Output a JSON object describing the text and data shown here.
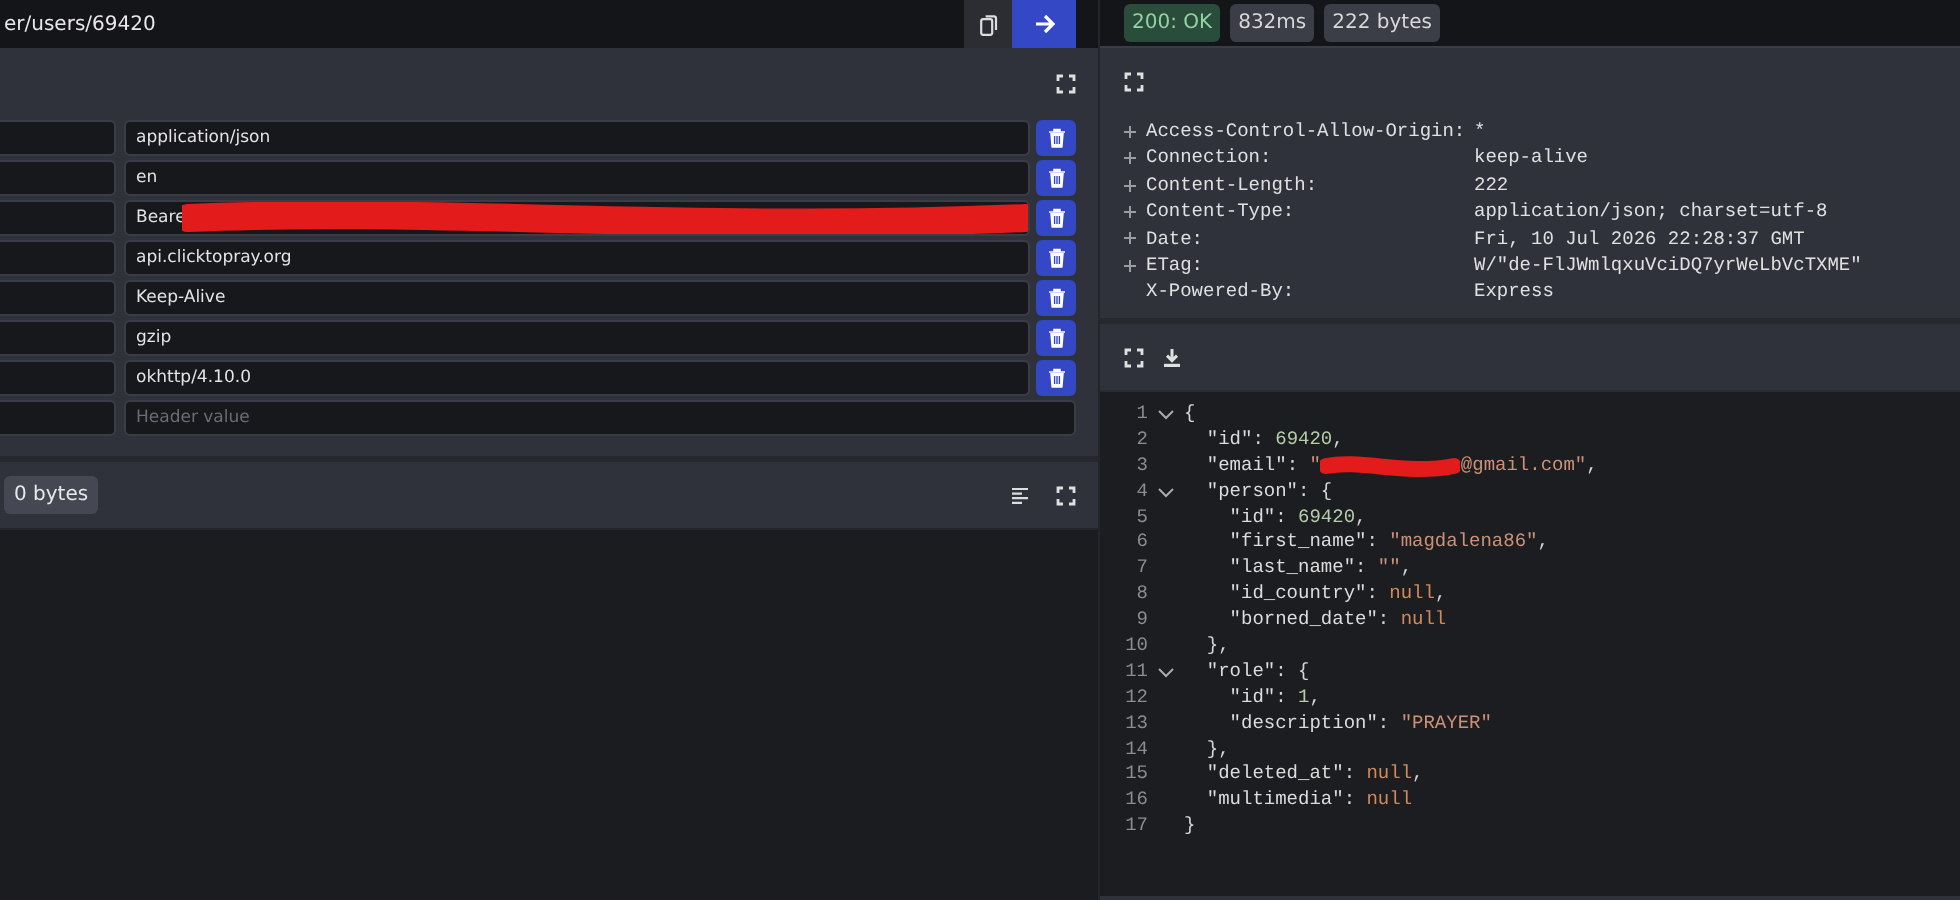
{
  "url_bar": {
    "value": "er/users/69420"
  },
  "request_headers": [
    {
      "value": "application/json",
      "redacted": false
    },
    {
      "value": "en",
      "redacted": false
    },
    {
      "value": "Beare",
      "redacted": true
    },
    {
      "value": "api.clicktopray.org",
      "redacted": false
    },
    {
      "value": "Keep-Alive",
      "redacted": false
    },
    {
      "value": "gzip",
      "redacted": false
    },
    {
      "value": "okhttp/4.10.0",
      "redacted": false
    }
  ],
  "new_header": {
    "placeholder": "Header value"
  },
  "request_body": {
    "size": "0 bytes"
  },
  "status": {
    "code": "200: OK",
    "time": "832ms",
    "size": "222 bytes"
  },
  "response_headers": [
    {
      "name": "Access-Control-Allow-Origin:",
      "value": "*",
      "expandable": true
    },
    {
      "name": "Connection:",
      "value": "keep-alive",
      "expandable": true
    },
    {
      "name": "Content-Length:",
      "value": "222",
      "expandable": true
    },
    {
      "name": "Content-Type:",
      "value": "application/json; charset=utf-8",
      "expandable": true
    },
    {
      "name": "Date:",
      "value": "Fri, 10 Jul 2026 22:28:37 GMT",
      "expandable": true
    },
    {
      "name": "ETag:",
      "value": "W/\"de-FlJWmlqxuVciDQ7yrWeLbVcTXME\"",
      "expandable": true
    },
    {
      "name": "X-Powered-By:",
      "value": "Express",
      "expandable": false
    }
  ],
  "response_body": {
    "lines": [
      {
        "number": "1",
        "foldable": true,
        "tokens": [
          {
            "kind": "punct",
            "text": "{"
          }
        ]
      },
      {
        "number": "2",
        "foldable": false,
        "tokens": [
          {
            "kind": "key",
            "text": "  \"id\""
          },
          {
            "kind": "punct",
            "text": ": "
          },
          {
            "kind": "number",
            "text": "69420"
          },
          {
            "kind": "punct",
            "text": ","
          }
        ]
      },
      {
        "number": "3",
        "foldable": false,
        "tokens": [
          {
            "kind": "key",
            "text": "  \"email\""
          },
          {
            "kind": "punct",
            "text": ": "
          },
          {
            "kind": "string",
            "text": "\""
          },
          {
            "kind": "redaction"
          },
          {
            "kind": "string",
            "text": "@gmail.com\""
          },
          {
            "kind": "punct",
            "text": ","
          }
        ]
      },
      {
        "number": "4",
        "foldable": true,
        "tokens": [
          {
            "kind": "key",
            "text": "  \"person\""
          },
          {
            "kind": "punct",
            "text": ": {"
          }
        ]
      },
      {
        "number": "5",
        "foldable": false,
        "tokens": [
          {
            "kind": "key",
            "text": "    \"id\""
          },
          {
            "kind": "punct",
            "text": ": "
          },
          {
            "kind": "number",
            "text": "69420"
          },
          {
            "kind": "punct",
            "text": ","
          }
        ]
      },
      {
        "number": "6",
        "foldable": false,
        "tokens": [
          {
            "kind": "key",
            "text": "    \"first_name\""
          },
          {
            "kind": "punct",
            "text": ": "
          },
          {
            "kind": "string",
            "text": "\"magdalena86\""
          },
          {
            "kind": "punct",
            "text": ","
          }
        ]
      },
      {
        "number": "7",
        "foldable": false,
        "tokens": [
          {
            "kind": "key",
            "text": "    \"last_name\""
          },
          {
            "kind": "punct",
            "text": ": "
          },
          {
            "kind": "string",
            "text": "\"\""
          },
          {
            "kind": "punct",
            "text": ","
          }
        ]
      },
      {
        "number": "8",
        "foldable": false,
        "tokens": [
          {
            "kind": "key",
            "text": "    \"id_country\""
          },
          {
            "kind": "punct",
            "text": ": "
          },
          {
            "kind": "null",
            "text": "null"
          },
          {
            "kind": "punct",
            "text": ","
          }
        ]
      },
      {
        "number": "9",
        "foldable": false,
        "tokens": [
          {
            "kind": "key",
            "text": "    \"borned_date\""
          },
          {
            "kind": "punct",
            "text": ": "
          },
          {
            "kind": "null",
            "text": "null"
          }
        ]
      },
      {
        "number": "10",
        "foldable": false,
        "tokens": [
          {
            "kind": "punct",
            "text": "  },"
          }
        ]
      },
      {
        "number": "11",
        "foldable": true,
        "tokens": [
          {
            "kind": "key",
            "text": "  \"role\""
          },
          {
            "kind": "punct",
            "text": ": {"
          }
        ]
      },
      {
        "number": "12",
        "foldable": false,
        "tokens": [
          {
            "kind": "key",
            "text": "    \"id\""
          },
          {
            "kind": "punct",
            "text": ": "
          },
          {
            "kind": "number",
            "text": "1"
          },
          {
            "kind": "punct",
            "text": ","
          }
        ]
      },
      {
        "number": "13",
        "foldable": false,
        "tokens": [
          {
            "kind": "key",
            "text": "    \"description\""
          },
          {
            "kind": "punct",
            "text": ": "
          },
          {
            "kind": "string",
            "text": "\"PRAYER\""
          }
        ]
      },
      {
        "number": "14",
        "foldable": false,
        "tokens": [
          {
            "kind": "punct",
            "text": "  },"
          }
        ]
      },
      {
        "number": "15",
        "foldable": false,
        "tokens": [
          {
            "kind": "key",
            "text": "  \"deleted_at\""
          },
          {
            "kind": "punct",
            "text": ": "
          },
          {
            "kind": "null",
            "text": "null"
          },
          {
            "kind": "punct",
            "text": ","
          }
        ]
      },
      {
        "number": "16",
        "foldable": false,
        "tokens": [
          {
            "kind": "key",
            "text": "  \"multimedia\""
          },
          {
            "kind": "punct",
            "text": ": "
          },
          {
            "kind": "null",
            "text": "null"
          }
        ]
      },
      {
        "number": "17",
        "foldable": false,
        "tokens": [
          {
            "kind": "punct",
            "text": "}"
          }
        ]
      }
    ]
  }
}
